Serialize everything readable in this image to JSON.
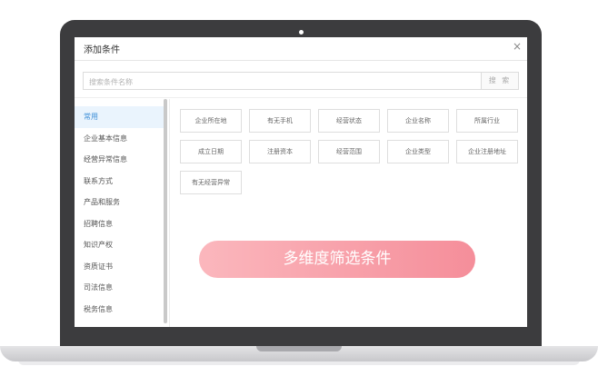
{
  "dialog": {
    "title": "添加条件",
    "close_glyph": "×"
  },
  "search": {
    "placeholder": "搜索条件名称",
    "button_label": "搜 索"
  },
  "sidebar": {
    "items": [
      {
        "label": "常用",
        "active": true
      },
      {
        "label": "企业基本信息"
      },
      {
        "label": "经营异常信息"
      },
      {
        "label": "联系方式"
      },
      {
        "label": "产品和服务"
      },
      {
        "label": "招聘信息"
      },
      {
        "label": "知识产权"
      },
      {
        "label": "资质证书"
      },
      {
        "label": "司法信息"
      },
      {
        "label": "税务信息"
      }
    ]
  },
  "options": {
    "items": [
      {
        "label": "企业所在地"
      },
      {
        "label": "有无手机"
      },
      {
        "label": "经营状态"
      },
      {
        "label": "企业名称"
      },
      {
        "label": "所属行业"
      },
      {
        "label": "成立日期"
      },
      {
        "label": "注册资本"
      },
      {
        "label": "经营范围"
      },
      {
        "label": "企业类型"
      },
      {
        "label": "企业注册地址"
      },
      {
        "label": "有无经营异常"
      }
    ]
  },
  "banner": {
    "text": "多维度筛选条件"
  },
  "colors": {
    "accent": "#3f8fd8",
    "banner_start": "#fbb7bd",
    "banner_end": "#f58e9a",
    "laptop_frame": "#3c3c3e"
  }
}
